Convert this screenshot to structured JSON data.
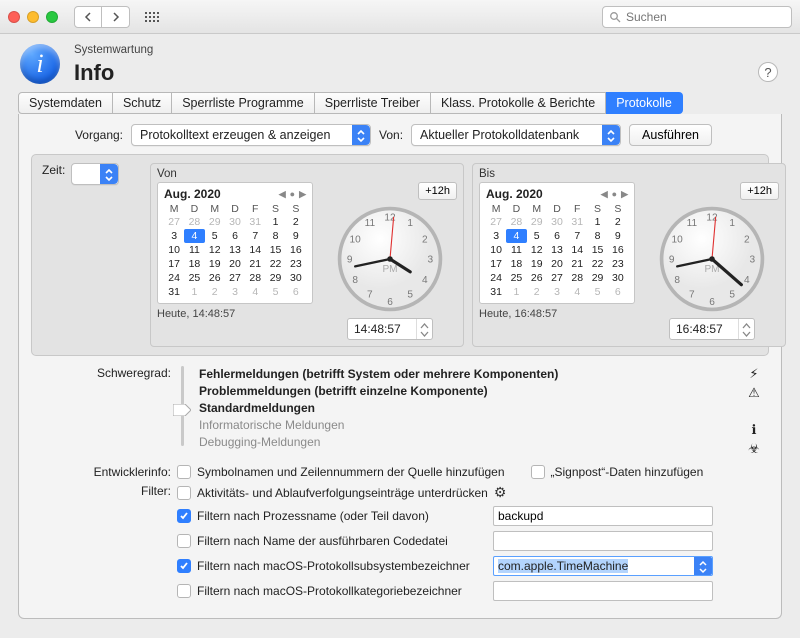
{
  "titlebar": {
    "search_placeholder": "Suchen"
  },
  "header": {
    "subtitle": "Systemwartung",
    "title": "Info",
    "help": "?"
  },
  "tabs": {
    "t1": "Systemdaten",
    "t2": "Schutz",
    "t3": "Sperrliste Programme",
    "t4": "Sperrliste Treiber",
    "t5": "Klass. Protokolle & Berichte",
    "t6": "Protokolle"
  },
  "vorgang": {
    "label": "Vorgang:",
    "action_value": "Protokolltext erzeugen & anzeigen",
    "von_label": "Von:",
    "source_value": "Aktueller Protokolldatenbank",
    "run": "Ausführen"
  },
  "zeit": {
    "label": "Zeit:",
    "value": ""
  },
  "time_from": {
    "title": "Von",
    "month": "Aug. 2020",
    "heute": "Heute, 14:48:57",
    "plus12": "+12h",
    "time": "14:48:57"
  },
  "time_to": {
    "title": "Bis",
    "month": "Aug. 2020",
    "heute": "Heute, 16:48:57",
    "plus12": "+12h",
    "time": "16:48:57"
  },
  "cal": {
    "dows": [
      "M",
      "D",
      "M",
      "D",
      "F",
      "S",
      "S"
    ],
    "rows": [
      [
        {
          "n": 27,
          "m": 1
        },
        {
          "n": 28,
          "m": 1
        },
        {
          "n": 29,
          "m": 1
        },
        {
          "n": 30,
          "m": 1
        },
        {
          "n": 31,
          "m": 1
        },
        {
          "n": 1
        },
        {
          "n": 2
        }
      ],
      [
        {
          "n": 3
        },
        {
          "n": 4,
          "sel": 1
        },
        {
          "n": 5
        },
        {
          "n": 6
        },
        {
          "n": 7
        },
        {
          "n": 8
        },
        {
          "n": 9
        }
      ],
      [
        {
          "n": 10
        },
        {
          "n": 11
        },
        {
          "n": 12
        },
        {
          "n": 13
        },
        {
          "n": 14
        },
        {
          "n": 15
        },
        {
          "n": 16
        }
      ],
      [
        {
          "n": 17
        },
        {
          "n": 18
        },
        {
          "n": 19
        },
        {
          "n": 20
        },
        {
          "n": 21
        },
        {
          "n": 22
        },
        {
          "n": 23
        }
      ],
      [
        {
          "n": 24
        },
        {
          "n": 25
        },
        {
          "n": 26
        },
        {
          "n": 27
        },
        {
          "n": 28
        },
        {
          "n": 29
        },
        {
          "n": 30
        }
      ],
      [
        {
          "n": 31
        },
        {
          "n": 1,
          "m": 1
        },
        {
          "n": 2,
          "m": 1
        },
        {
          "n": 3,
          "m": 1
        },
        {
          "n": 4,
          "m": 1
        },
        {
          "n": 5,
          "m": 1
        },
        {
          "n": 6,
          "m": 1
        }
      ]
    ]
  },
  "severity": {
    "label": "Schweregrad:",
    "l1": "Fehlermeldungen (betrifft System oder mehrere Komponenten)",
    "l2": "Problemmeldungen (betrifft einzelne Komponente)",
    "l3": "Standardmeldungen",
    "l4": "Informatorische Meldungen",
    "l5": "Debugging-Meldungen"
  },
  "dev": {
    "label": "Entwicklerinfo:",
    "symnames": "Symbolnamen und Zeilennummern der Quelle hinzufügen",
    "signpost": "„Signpost“-Daten hinzufügen"
  },
  "filter": {
    "label": "Filter:",
    "suppress": "Aktivitäts- und Ablaufverfolgungseinträge unterdrücken",
    "proc_label": "Filtern nach Prozessname (oder Teil davon)",
    "proc_value": "backupd",
    "exec_label": "Filtern nach Name der ausführbaren Codedatei",
    "subsys_label": "Filtern nach macOS-Protokollsubsystembezeichner",
    "subsys_value": "com.apple.TimeMachine",
    "cat_label": "Filtern nach macOS-Protokollkategoriebezeichner"
  },
  "clock": {
    "ampm": "PM"
  }
}
